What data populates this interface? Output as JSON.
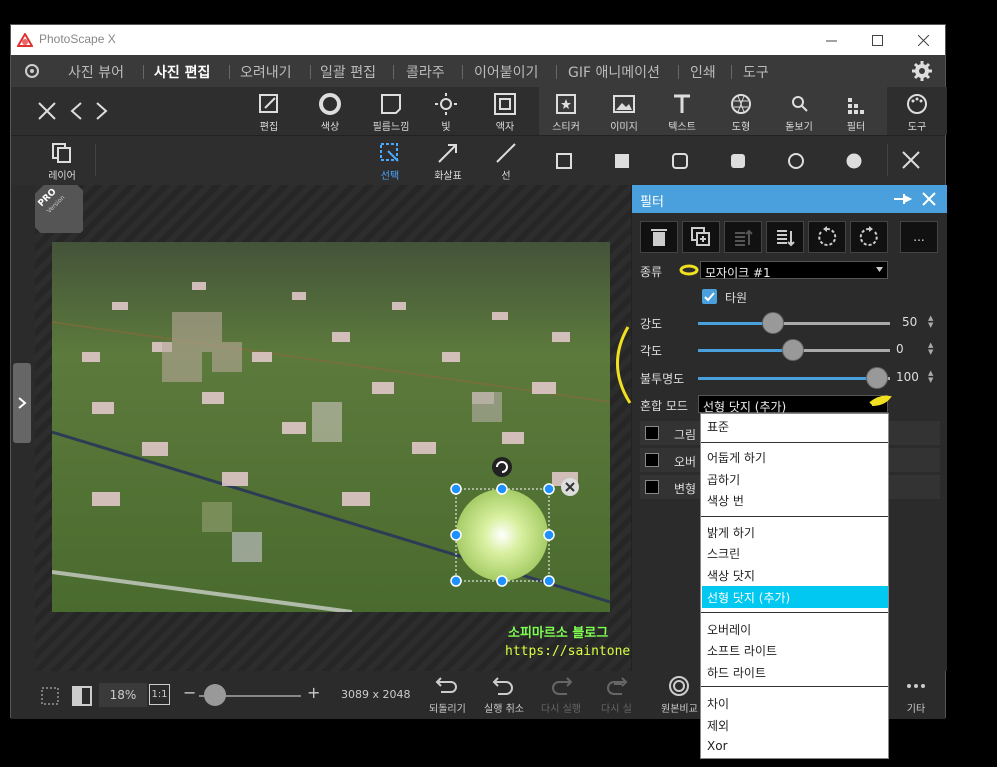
{
  "window": {
    "title": "PhotoScape X"
  },
  "menu": {
    "items": [
      "사진 뷰어",
      "사진 편집",
      "오려내기",
      "일괄 편집",
      "콜라주",
      "이어붙이기",
      "GIF 애니메이션",
      "인쇄",
      "도구"
    ],
    "active": "사진 편집"
  },
  "toolbar": {
    "left": [
      "편집",
      "색상",
      "필름느낌",
      "빛",
      "액자"
    ],
    "right": [
      "스티커",
      "이미지",
      "텍스트",
      "도형",
      "돋보기",
      "필터",
      "도구"
    ]
  },
  "subtoolbar": {
    "layer_label": "레이어",
    "select_label": "선택",
    "arrow_label": "화살표",
    "line_label": "선"
  },
  "badge": {
    "text": "PRO",
    "sub": "Version"
  },
  "filter_panel": {
    "title": "필터",
    "type_label": "종류",
    "type_value": "모자이크 #1",
    "ellipse_label": "타원",
    "ellipse_checked": true,
    "strength_label": "강도",
    "strength_value": "50",
    "angle_label": "각도",
    "angle_value": "0",
    "opacity_label": "불투명도",
    "opacity_value": "100",
    "blend_label": "혼합 모드",
    "blend_value": "선형 닷지 (추가)",
    "more_label": "...",
    "shadow_label": "그림",
    "overlay_label": "오버",
    "transform_label": "변형"
  },
  "blend_options": {
    "group1": [
      "표준"
    ],
    "group2": [
      "어둡게 하기",
      "곱하기",
      "색상 번"
    ],
    "group3": [
      "밝게 하기",
      "스크린",
      "색상 닷지",
      "선형 닷지 (추가)"
    ],
    "group4": [
      "오버레이",
      "소프트 라이트",
      "하드 라이트"
    ],
    "group5": [
      "차이",
      "제외",
      "Xor"
    ],
    "selected": "선형 닷지 (추가)"
  },
  "watermark": {
    "line1": "소피마르소 블로그",
    "line2": "https://saintone.tistory.com"
  },
  "bottombar": {
    "zoom": "18%",
    "actual": "1:1",
    "dimensions": "3089 x 2048",
    "revert": "되돌리기",
    "undo": "실행 취소",
    "redo": "다시 실행",
    "redo_all": "다시 실",
    "compare": "원본비교",
    "more": "기타",
    "zoom_slider": 0.1
  }
}
